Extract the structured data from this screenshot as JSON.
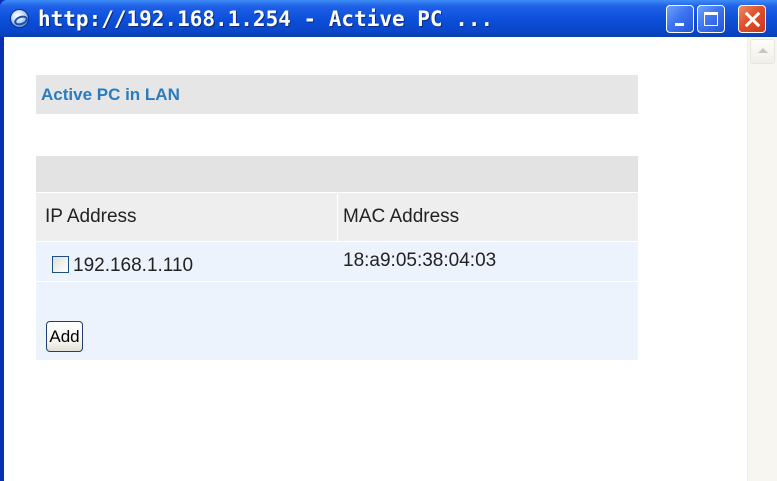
{
  "window": {
    "title": "http://192.168.1.254 - Active PC ...",
    "controls": {
      "minimize": "minimize-icon",
      "maximize": "maximize-icon",
      "close": "close-icon"
    }
  },
  "panel": {
    "title": "Active PC in LAN",
    "columns": [
      "IP Address",
      "MAC Address"
    ],
    "rows": [
      {
        "checked": false,
        "ip": "192.168.1.110",
        "mac": "18:a9:05:38:04:03"
      }
    ],
    "add_label": "Add"
  },
  "colors": {
    "titlebar": "#0b4ed8",
    "panel_title": "#2a7bc0",
    "header_bg": "#e6e6e6",
    "row_bg": "#edf3fd"
  }
}
